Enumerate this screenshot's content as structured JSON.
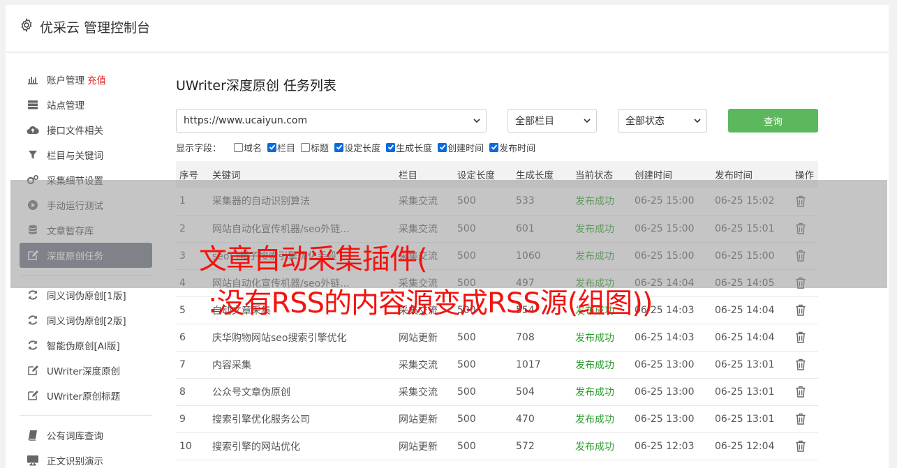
{
  "header": {
    "title": "优采云 管理控制台",
    "icon": "gear-icon"
  },
  "sidebar": {
    "groups": [
      [
        {
          "label": "账户管理",
          "extra": "充值",
          "icon": "bar-chart-icon"
        },
        {
          "label": "站点管理",
          "icon": "server-icon"
        },
        {
          "label": "接口文件相关",
          "icon": "cloud-upload-icon"
        },
        {
          "label": "栏目与关键词",
          "icon": "filter-icon"
        },
        {
          "label": "采集细节设置",
          "icon": "cogs-icon"
        },
        {
          "label": "手动运行测试",
          "icon": "play-circle-icon"
        },
        {
          "label": "文章暂存库",
          "icon": "database-icon"
        },
        {
          "label": "深度原创任务",
          "icon": "edit-icon",
          "active": true
        }
      ],
      [
        {
          "label": "同义词伪原创[1版]",
          "icon": "refresh-icon"
        },
        {
          "label": "同义词伪原创[2版]",
          "icon": "refresh-icon"
        },
        {
          "label": "智能伪原创[AI版]",
          "icon": "refresh-icon"
        },
        {
          "label": "UWriter深度原创",
          "icon": "edit-icon"
        },
        {
          "label": "UWriter原创标题",
          "icon": "edit-icon"
        }
      ],
      [
        {
          "label": "公有词库查询",
          "icon": "book-icon"
        },
        {
          "label": "正文识别演示",
          "icon": "monitor-icon"
        }
      ]
    ]
  },
  "page": {
    "title": "UWriter深度原创 任务列表"
  },
  "filters": {
    "site": "https://www.ucaiyun.com",
    "column": "全部栏目",
    "status": "全部状态",
    "query_label": "查询"
  },
  "fields": {
    "label": "显示字段：",
    "items": [
      {
        "label": "域名",
        "checked": false
      },
      {
        "label": "栏目",
        "checked": true
      },
      {
        "label": "标题",
        "checked": false
      },
      {
        "label": "设定长度",
        "checked": true
      },
      {
        "label": "生成长度",
        "checked": true
      },
      {
        "label": "创建时间",
        "checked": true
      },
      {
        "label": "发布时间",
        "checked": true
      }
    ]
  },
  "table": {
    "headers": [
      "序号",
      "关键词",
      "栏目",
      "设定长度",
      "生成长度",
      "当前状态",
      "创建时间",
      "发布时间",
      "操作"
    ],
    "rows": [
      [
        "1",
        "采集器的自动识别算法",
        "采集交流",
        "500",
        "533",
        "发布成功",
        "06-25 15:00",
        "06-25 15:02"
      ],
      [
        "2",
        "网站自动化宣传机器/seo外链...",
        "采集交流",
        "500",
        "601",
        "发布成功",
        "06-25 15:00",
        "06-25 15:01"
      ],
      [
        "3",
        "seo白帽子搜索引擎优化手段",
        "采集交流",
        "500",
        "1060",
        "发布成功",
        "06-25 15:00",
        "06-25 15:00"
      ],
      [
        "4",
        "网站自动化宣传机器/seo外链...",
        "采集交流",
        "500",
        "497",
        "发布成功",
        "06-25 14:04",
        "06-25 14:05"
      ],
      [
        "5",
        "自动文章采集",
        "采集交流",
        "500",
        "554",
        "发布成功",
        "06-25 14:03",
        "06-25 14:04"
      ],
      [
        "6",
        "庆华购物网站seo搜索引擎优化",
        "网站更新",
        "500",
        "708",
        "发布成功",
        "06-25 14:03",
        "06-25 14:04"
      ],
      [
        "7",
        "内容采集",
        "采集交流",
        "500",
        "1017",
        "发布成功",
        "06-25 13:00",
        "06-25 13:01"
      ],
      [
        "8",
        "公众号文章伪原创",
        "采集交流",
        "500",
        "504",
        "发布成功",
        "06-25 13:00",
        "06-25 13:01"
      ],
      [
        "9",
        "搜索引擎优化服务公司",
        "网站更新",
        "500",
        "470",
        "发布成功",
        "06-25 13:00",
        "06-25 13:01"
      ],
      [
        "10",
        "搜索引擎的网站优化",
        "网站更新",
        "500",
        "572",
        "发布成功",
        "06-25 12:03",
        "06-25 12:04"
      ]
    ]
  },
  "overlay": {
    "line1": "文章自动采集插件(",
    "line2": ":没有RSS的内容源变成RSS源(组图))"
  },
  "colors": {
    "accent": "#5cb85c",
    "active_nav": "#646e7a",
    "success": "#2a9d2a",
    "overlay_text": "#f2130f",
    "charge": "#e02020"
  }
}
